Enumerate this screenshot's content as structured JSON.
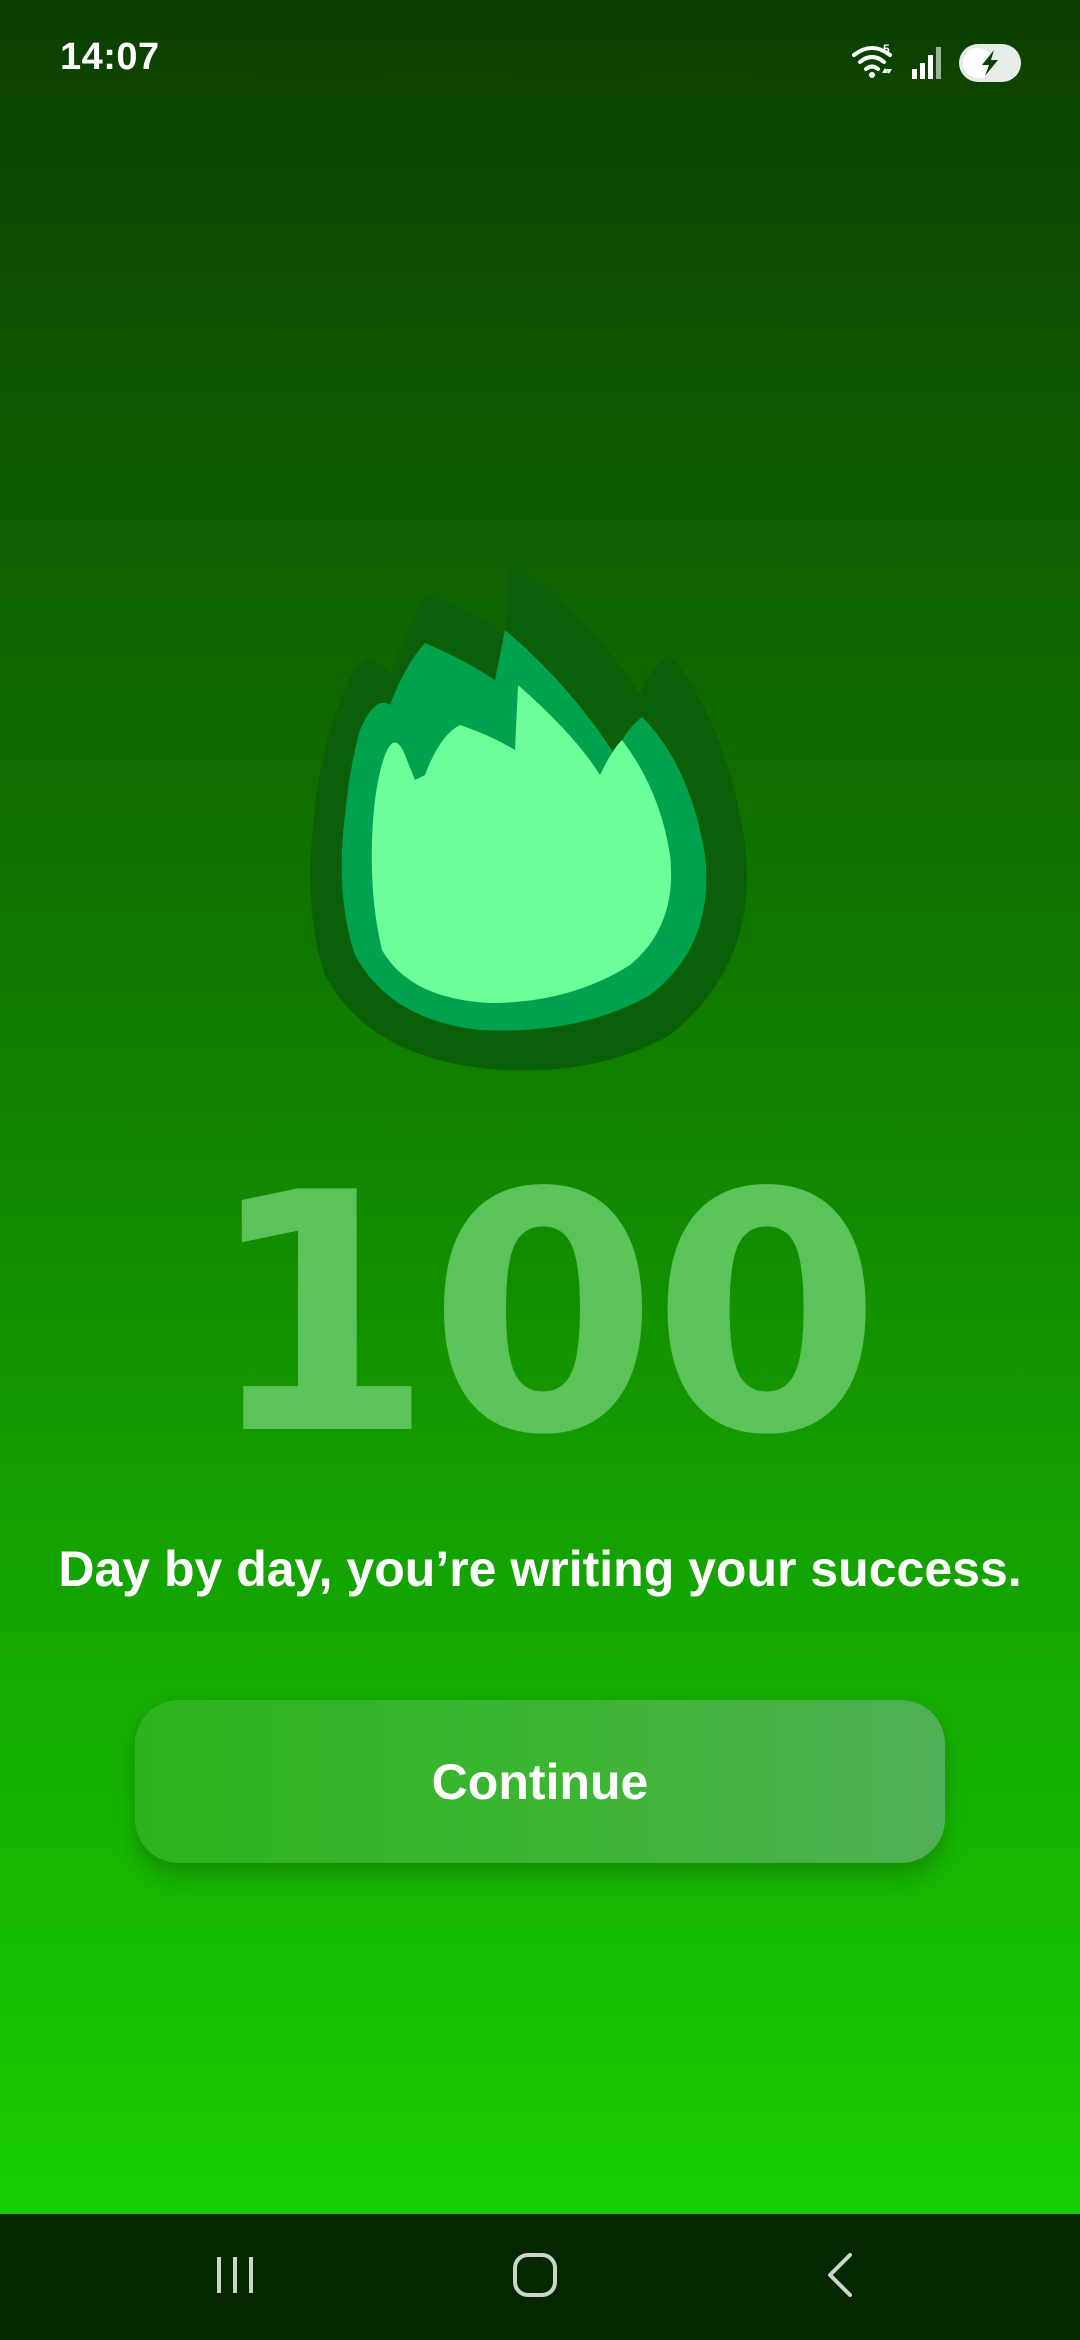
{
  "status_bar": {
    "time": "14:07",
    "wifi_badge": "5",
    "icons": [
      "wifi-icon",
      "signal-icon",
      "battery-charging-icon"
    ]
  },
  "streak": {
    "count": "100",
    "message": "Day by day, you’re writing your success.",
    "icon": "flame-icon"
  },
  "actions": {
    "continue_label": "Continue"
  },
  "nav_bar": {
    "buttons": [
      "recent-apps",
      "home",
      "back"
    ]
  },
  "colors": {
    "background_top": "#0b3f00",
    "background_bottom": "#1ad600",
    "flame_outer": "#0a5f08",
    "flame_middle": "#00a24e",
    "flame_inner": "#6cff9a",
    "number_color": "#5bc35a",
    "button_color": "#3db534",
    "nav_bar": "#052700"
  }
}
